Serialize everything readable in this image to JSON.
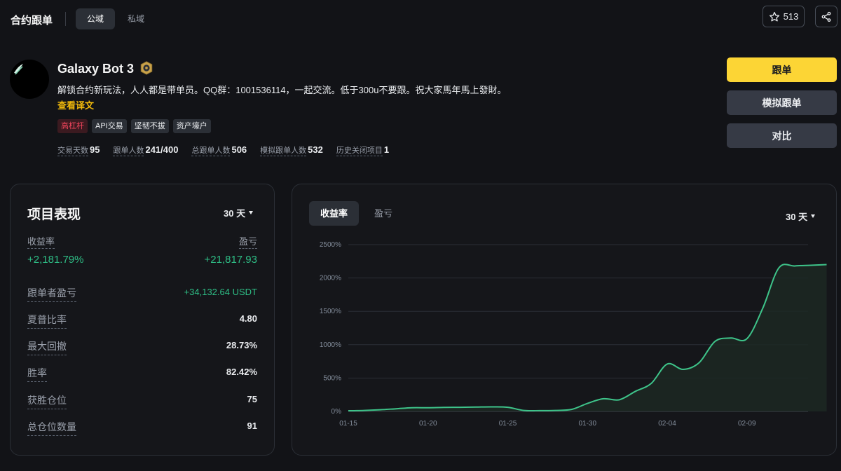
{
  "header": {
    "title": "合约跟单",
    "tabs": [
      {
        "label": "公域",
        "active": true
      },
      {
        "label": "私域",
        "active": false
      }
    ],
    "star_count": "513"
  },
  "profile": {
    "name": "Galaxy Bot 3",
    "description": "解锁合约新玩法，人人都是带单员。QQ群：1001536114，一起交流。低于300u不要跟。祝大家馬年馬上發財。",
    "translate_link": "查看译文",
    "tags": [
      {
        "label": "高杠杆",
        "style": "red"
      },
      {
        "label": "API交易",
        "style": "normal"
      },
      {
        "label": "坚韧不拔",
        "style": "normal"
      },
      {
        "label": "资产壕户",
        "style": "normal"
      }
    ],
    "stats": [
      {
        "label": "交易天数",
        "value": "95"
      },
      {
        "label": "跟单人数",
        "value": "241/400"
      },
      {
        "label": "总跟单人数",
        "value": "506"
      },
      {
        "label": "模拟跟单人数",
        "value": "532"
      },
      {
        "label": "历史关闭项目",
        "value": "1"
      }
    ]
  },
  "actions": {
    "copy": "跟单",
    "mock_copy": "模拟跟单",
    "compare": "对比"
  },
  "performance": {
    "title": "项目表现",
    "period": "30 天",
    "roi_label": "收益率",
    "roi_value": "+2,181.79%",
    "pnl_label": "盈亏",
    "pnl_value": "+21,817.93",
    "metrics": [
      {
        "label": "跟单者盈亏",
        "value": "+34,132.64 USDT",
        "green": true
      },
      {
        "label": "夏普比率",
        "value": "4.80"
      },
      {
        "label": "最大回撤",
        "value": "28.73%"
      },
      {
        "label": "胜率",
        "value": "82.42%"
      },
      {
        "label": "获胜仓位",
        "value": "75"
      },
      {
        "label": "总仓位数量",
        "value": "91"
      }
    ]
  },
  "chart_panel": {
    "tabs": [
      {
        "label": "收益率",
        "active": true
      },
      {
        "label": "盈亏",
        "active": false
      }
    ],
    "period": "30 天"
  },
  "colors": {
    "accent": "#fcd535",
    "positive": "#2ebd85",
    "negative": "#f6465d",
    "line": "#3ec48a"
  },
  "chart_data": {
    "type": "area",
    "title": "",
    "xlabel": "",
    "ylabel": "",
    "ylim": [
      0,
      2500
    ],
    "yticks": [
      "0%",
      "500%",
      "1000%",
      "1500%",
      "2000%",
      "2500%"
    ],
    "xticks": [
      "01-15",
      "01-20",
      "01-25",
      "01-30",
      "02-04",
      "02-09"
    ],
    "grid": true,
    "series": [
      {
        "x": [
          "01-15",
          "01-16",
          "01-17",
          "01-18",
          "01-19",
          "01-20",
          "01-21",
          "01-22",
          "01-23",
          "01-24",
          "01-25",
          "01-26",
          "01-27",
          "01-28",
          "01-29",
          "01-30",
          "01-31",
          "02-01",
          "02-02",
          "02-03",
          "02-04",
          "02-05",
          "02-06",
          "02-07",
          "02-08",
          "02-09",
          "02-10",
          "02-11",
          "02-12",
          "02-13",
          "02-14"
        ],
        "y": [
          10,
          15,
          25,
          40,
          55,
          55,
          60,
          62,
          65,
          68,
          62,
          15,
          12,
          15,
          30,
          120,
          190,
          175,
          300,
          420,
          710,
          630,
          730,
          1050,
          1100,
          1090,
          1550,
          2150,
          2180,
          2190,
          2200
        ]
      }
    ]
  }
}
